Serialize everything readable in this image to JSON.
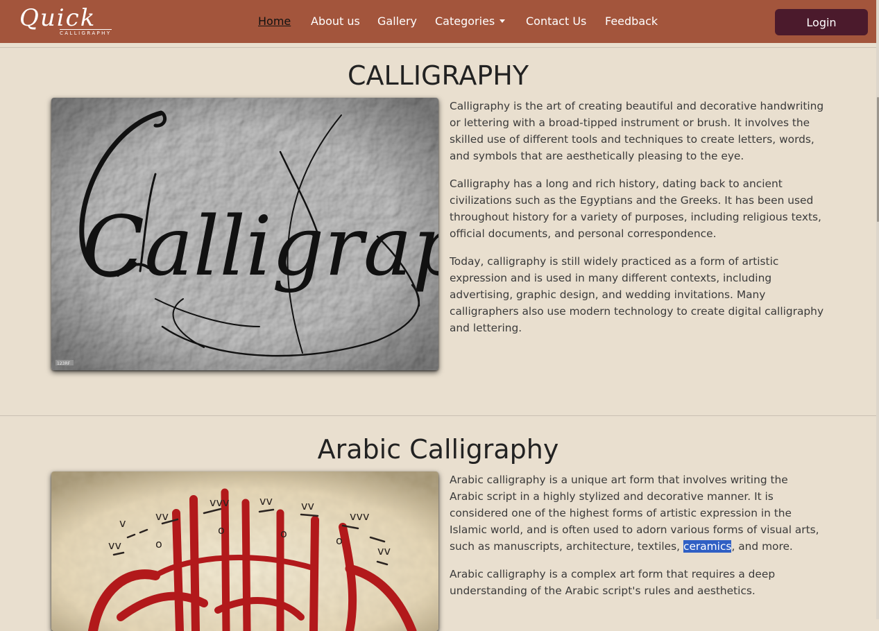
{
  "navbar": {
    "brand_script": "Quick",
    "brand_sub": "CALLIGRAPHY",
    "links": [
      "Home",
      "About us",
      "Gallery",
      "Categories",
      "Contact Us",
      "Feedback"
    ],
    "active_link": "Home",
    "login_label": "Login"
  },
  "section1": {
    "title": "CALLIGRAPHY",
    "image_word": "Calligraphy",
    "image_watermark": "123RF",
    "paragraphs": [
      "Calligraphy is the art of creating beautiful and decorative handwriting or lettering with a broad-tipped instrument or brush. It involves the skilled use of different tools and techniques to create letters, words, and symbols that are aesthetically pleasing to the eye.",
      "Calligraphy has a long and rich history, dating back to ancient civilizations such as the Egyptians and the Greeks. It has been used throughout history for a variety of purposes, including religious texts, official documents, and personal correspondence.",
      "Today, calligraphy is still widely practiced as a form of artistic expression and is used in many different contexts, including advertising, graphic design, and wedding invitations. Many calligraphers also use modern technology to create digital calligraphy and lettering."
    ]
  },
  "section2": {
    "title": "Arabic Calligraphy",
    "p1_before": "Arabic calligraphy is a unique art form that involves writing the Arabic script in a highly stylized and decorative manner. It is considered one of the highest forms of artistic expression in the Islamic world, and is often used to adorn various forms of visual arts, such as manuscripts, architecture, textiles,",
    "p1_highlight": "ceramics",
    "p1_after": ", and more.",
    "p2": "Arabic calligraphy is a complex art form that requires a deep understanding of the Arabic script's rules and aesthetics."
  },
  "colors": {
    "navbar": "#a3553c",
    "login_button": "#4b1a2c",
    "page_background": "#e9dfcf",
    "selection_highlight": "#2f5fc4"
  }
}
